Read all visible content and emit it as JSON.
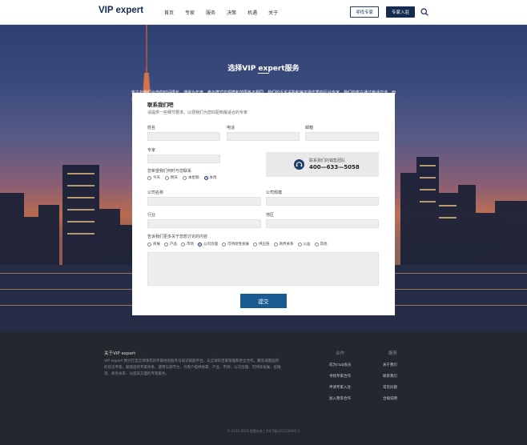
{
  "header": {
    "logo": "VIP expert",
    "nav": [
      "首页",
      "专家",
      "服务",
      "决策",
      "机遇",
      "关于"
    ],
    "find_expert": "寻找专家",
    "join_expert": "专家入驻"
  },
  "hero": {
    "title": "选择VIP expert服务",
    "description": "客户与我们合作的时间很长。通常为年度。参与模式的规模和范围各不相同。我们的近乎采购和兼定最优秀的行业专家。我们的客户通过电话交谈、面对面会议或在天研讨会与他们互动。"
  },
  "form": {
    "title": "联系我们吧",
    "subtitle": "请提供一些细节要求。以便我们为您匹配到最适合的专家",
    "name_label": "姓名",
    "phone_label": "电话",
    "email_label": "邮箱",
    "expert_label": "专家",
    "contact_time_label": "您希望我们何时与您联系",
    "contact_time_options": [
      "今天",
      "明天",
      "本星期",
      "本周"
    ],
    "contact_time_selected": 3,
    "sales_team_label": "联系我们的销售团队",
    "sales_phone": "400—633—5058",
    "company_name_label": "公司名称",
    "company_size_label": "公司规模",
    "industry_label": "行业",
    "region_label": "地区",
    "topic_label": "告诉我们更多关于您想讨论的内容",
    "topic_options": [
      "商展",
      "产品",
      "市场",
      "公司治理",
      "可持续性发展",
      "供应链",
      "商界关系",
      "公益",
      "其他"
    ],
    "topic_selected": 3,
    "submit_label": "提交"
  },
  "footer": {
    "about_title": "关于VIP expert",
    "about_desc": "VIP expert 致力打造全球领先的专家经验服务与知识赋能平台，与全球的百家管理和更企合作。聚焦海量国内的前沿专家，赋能后的专家体系、使用与调节力，为客户提供依靠、产业、市场、公司治理、可持续发展、投融资、商务关系、以提高方面的专家服务。",
    "col1_title": "合作",
    "col1_items": [
      "成为club会员",
      "寻找专家合作",
      "申请专家入驻",
      "加入我等合作"
    ],
    "col2_title": "服务",
    "col2_items": [
      "关于我们",
      "联系我们",
      "常见问题",
      "合规说明"
    ],
    "copyright": "© 2012-2019 智慧未来 | 京ICP备12015368号-1"
  },
  "colors": {
    "brand_navy": "#152a4f",
    "submit_blue": "#1a5b92",
    "footer_bg": "#24282e"
  }
}
